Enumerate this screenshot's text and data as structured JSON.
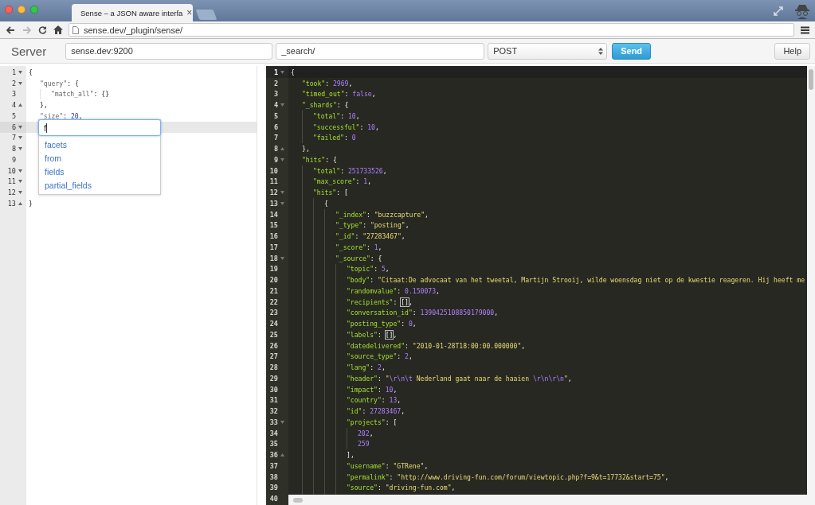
{
  "browser": {
    "tab_title": "Sense – a JSON aware interfa",
    "tab_close": "×",
    "url": "sense.dev/_plugin/sense/",
    "forward_disabled": true
  },
  "toolbar": {
    "title": "Server",
    "server": "sense.dev:9200",
    "path": "_search/",
    "method": "POST",
    "send": "Send",
    "help": "Help"
  },
  "request_editor": {
    "lines": [
      {
        "number": "1",
        "fold": true,
        "active": false,
        "tokens": [
          {
            "kind": "open",
            "text": "{"
          }
        ]
      },
      {
        "number": "2",
        "fold": true,
        "active": false,
        "tokens": [
          {
            "kind": "key",
            "text": "\"query\""
          },
          {
            "kind": "punct",
            "text": ": "
          },
          {
            "kind": "open",
            "text": "{"
          }
        ]
      },
      {
        "number": "3",
        "active": false,
        "tokens": [
          {
            "kind": "key",
            "text": "\"match_all\""
          },
          {
            "kind": "punct",
            "text": ": {}"
          }
        ]
      },
      {
        "number": "4",
        "fold": true,
        "active": false,
        "tokens": [
          {
            "kind": "close",
            "text": "}"
          },
          {
            "kind": "punct",
            "text": ","
          }
        ]
      },
      {
        "number": "5",
        "active": false,
        "tokens": [
          {
            "kind": "key",
            "text": "\"size\""
          },
          {
            "kind": "punct",
            "text": ": "
          },
          {
            "kind": "num",
            "text": "20"
          },
          {
            "kind": "punct",
            "text": ","
          }
        ]
      },
      {
        "number": "6",
        "fold": true,
        "active": true
      },
      {
        "number": "7",
        "fold": true,
        "active": false
      },
      {
        "number": "8",
        "fold": true,
        "active": false
      },
      {
        "number": "9",
        "active": false
      },
      {
        "number": "10",
        "fold": true,
        "active": false
      },
      {
        "number": "11",
        "fold": true,
        "active": false
      },
      {
        "number": "12",
        "fold": true,
        "active": false
      },
      {
        "number": "13",
        "fold": true,
        "active": false,
        "tokens": [
          {
            "kind": "close",
            "text": "}"
          }
        ]
      }
    ],
    "autocomplete": {
      "value": "f",
      "suggestions": [
        "facets",
        "from",
        "fields",
        "partial_fields"
      ]
    }
  },
  "response_editor": {
    "lines": [
      {
        "number": "1",
        "fold": true,
        "active": true,
        "tokens": [
          {
            "kind": "open",
            "text": "{"
          }
        ]
      },
      {
        "number": "2",
        "active": false,
        "tokens": [
          {
            "kind": "key",
            "text": "\"took\""
          },
          {
            "kind": "punct",
            "text": ": "
          },
          {
            "kind": "num",
            "text": "2969"
          },
          {
            "kind": "punct",
            "text": ","
          }
        ]
      },
      {
        "number": "3",
        "active": false,
        "tokens": [
          {
            "kind": "key",
            "text": "\"timed_out\""
          },
          {
            "kind": "punct",
            "text": ": "
          },
          {
            "kind": "num",
            "text": "false"
          },
          {
            "kind": "punct",
            "text": ","
          }
        ]
      },
      {
        "number": "4",
        "fold": true,
        "active": false,
        "tokens": [
          {
            "kind": "key",
            "text": "\"_shards\""
          },
          {
            "kind": "punct",
            "text": ": "
          },
          {
            "kind": "open",
            "text": "{"
          }
        ]
      },
      {
        "number": "5",
        "active": false,
        "tokens": [
          {
            "kind": "key",
            "text": "\"total\""
          },
          {
            "kind": "punct",
            "text": ": "
          },
          {
            "kind": "num",
            "text": "10"
          },
          {
            "kind": "punct",
            "text": ","
          }
        ]
      },
      {
        "number": "6",
        "active": false,
        "tokens": [
          {
            "kind": "key",
            "text": "\"successful\""
          },
          {
            "kind": "punct",
            "text": ": "
          },
          {
            "kind": "num",
            "text": "10"
          },
          {
            "kind": "punct",
            "text": ","
          }
        ]
      },
      {
        "number": "7",
        "active": false,
        "tokens": [
          {
            "kind": "key",
            "text": "\"failed\""
          },
          {
            "kind": "punct",
            "text": ": "
          },
          {
            "kind": "num",
            "text": "0"
          }
        ]
      },
      {
        "number": "8",
        "fold": true,
        "active": false,
        "tokens": [
          {
            "kind": "close",
            "text": "}"
          },
          {
            "kind": "punct",
            "text": ","
          }
        ]
      },
      {
        "number": "9",
        "fold": true,
        "active": false,
        "tokens": [
          {
            "kind": "key",
            "text": "\"hits\""
          },
          {
            "kind": "punct",
            "text": ": "
          },
          {
            "kind": "open",
            "text": "{"
          }
        ]
      },
      {
        "number": "10",
        "active": false,
        "tokens": [
          {
            "kind": "key",
            "text": "\"total\""
          },
          {
            "kind": "punct",
            "text": ": "
          },
          {
            "kind": "num",
            "text": "251733526"
          },
          {
            "kind": "punct",
            "text": ","
          }
        ]
      },
      {
        "number": "11",
        "active": false,
        "tokens": [
          {
            "kind": "key",
            "text": "\"max_score\""
          },
          {
            "kind": "punct",
            "text": ": "
          },
          {
            "kind": "num",
            "text": "1"
          },
          {
            "kind": "punct",
            "text": ","
          }
        ]
      },
      {
        "number": "12",
        "fold": true,
        "active": false,
        "tokens": [
          {
            "kind": "key",
            "text": "\"hits\""
          },
          {
            "kind": "punct",
            "text": ": "
          },
          {
            "kind": "open",
            "text": "["
          }
        ]
      },
      {
        "number": "13",
        "fold": true,
        "active": false,
        "tokens": [
          {
            "kind": "open",
            "text": "{"
          }
        ]
      },
      {
        "number": "14",
        "active": false,
        "tokens": [
          {
            "kind": "key",
            "text": "\"_index\""
          },
          {
            "kind": "punct",
            "text": ": "
          },
          {
            "kind": "str",
            "text": "\"buzzcapture\""
          },
          {
            "kind": "punct",
            "text": ","
          }
        ]
      },
      {
        "number": "15",
        "active": false,
        "tokens": [
          {
            "kind": "key",
            "text": "\"_type\""
          },
          {
            "kind": "punct",
            "text": ": "
          },
          {
            "kind": "str",
            "text": "\"posting\""
          },
          {
            "kind": "punct",
            "text": ","
          }
        ]
      },
      {
        "number": "16",
        "active": false,
        "tokens": [
          {
            "kind": "key",
            "text": "\"_id\""
          },
          {
            "kind": "punct",
            "text": ": "
          },
          {
            "kind": "str",
            "text": "\"27283467\""
          },
          {
            "kind": "punct",
            "text": ","
          }
        ]
      },
      {
        "number": "17",
        "active": false,
        "tokens": [
          {
            "kind": "key",
            "text": "\"_score\""
          },
          {
            "kind": "punct",
            "text": ": "
          },
          {
            "kind": "num",
            "text": "1"
          },
          {
            "kind": "punct",
            "text": ","
          }
        ]
      },
      {
        "number": "18",
        "fold": true,
        "active": false,
        "tokens": [
          {
            "kind": "key",
            "text": "\"_source\""
          },
          {
            "kind": "punct",
            "text": ": "
          },
          {
            "kind": "open",
            "text": "{"
          }
        ]
      },
      {
        "number": "19",
        "active": false,
        "tokens": [
          {
            "kind": "key",
            "text": "\"topic\""
          },
          {
            "kind": "punct",
            "text": ": "
          },
          {
            "kind": "num",
            "text": "5"
          },
          {
            "kind": "punct",
            "text": ","
          }
        ]
      },
      {
        "number": "20",
        "active": false,
        "tokens": [
          {
            "kind": "key",
            "text": "\"body\""
          },
          {
            "kind": "punct",
            "text": ": "
          },
          {
            "kind": "str",
            "text": "\"Citaat:De advocaat van het tweetal, Martijn Strooij, wilde woensdag niet op de kwestie reageren. Hij heeft me"
          }
        ]
      },
      {
        "number": "21",
        "active": false,
        "tokens": [
          {
            "kind": "key",
            "text": "\"randomvalue\""
          },
          {
            "kind": "punct",
            "text": ": "
          },
          {
            "kind": "num",
            "text": "0.150073"
          },
          {
            "kind": "punct",
            "text": ","
          }
        ]
      },
      {
        "number": "22",
        "active": false,
        "tokens": [
          {
            "kind": "key",
            "text": "\"recipients\""
          },
          {
            "kind": "punct",
            "text": ": "
          },
          {
            "kind": "empty",
            "text": "[]"
          },
          {
            "kind": "punct",
            "text": ","
          }
        ]
      },
      {
        "number": "23",
        "active": false,
        "tokens": [
          {
            "kind": "key",
            "text": "\"conversation_id\""
          },
          {
            "kind": "punct",
            "text": ": "
          },
          {
            "kind": "num",
            "text": "1390425108850179000"
          },
          {
            "kind": "punct",
            "text": ","
          }
        ]
      },
      {
        "number": "24",
        "active": false,
        "tokens": [
          {
            "kind": "key",
            "text": "\"posting_type\""
          },
          {
            "kind": "punct",
            "text": ": "
          },
          {
            "kind": "num",
            "text": "0"
          },
          {
            "kind": "punct",
            "text": ","
          }
        ]
      },
      {
        "number": "25",
        "active": false,
        "tokens": [
          {
            "kind": "key",
            "text": "\"labels\""
          },
          {
            "kind": "punct",
            "text": ": "
          },
          {
            "kind": "empty",
            "text": "[]"
          },
          {
            "kind": "punct",
            "text": ","
          }
        ]
      },
      {
        "number": "26",
        "active": false,
        "tokens": [
          {
            "kind": "key",
            "text": "\"datedelivered\""
          },
          {
            "kind": "punct",
            "text": ": "
          },
          {
            "kind": "str",
            "text": "\"2010-01-28T18:00:00.000000\""
          },
          {
            "kind": "punct",
            "text": ","
          }
        ]
      },
      {
        "number": "27",
        "active": false,
        "tokens": [
          {
            "kind": "key",
            "text": "\"source_type\""
          },
          {
            "kind": "punct",
            "text": ": "
          },
          {
            "kind": "num",
            "text": "2"
          },
          {
            "kind": "punct",
            "text": ","
          }
        ]
      },
      {
        "number": "28",
        "active": false,
        "tokens": [
          {
            "kind": "key",
            "text": "\"lang\""
          },
          {
            "kind": "punct",
            "text": ": "
          },
          {
            "kind": "num",
            "text": "2"
          },
          {
            "kind": "punct",
            "text": ","
          }
        ]
      },
      {
        "number": "29",
        "active": false,
        "tokens": [
          {
            "kind": "key",
            "text": "\"header\""
          },
          {
            "kind": "punct",
            "text": ": "
          },
          {
            "kind": "str",
            "text": "\""
          },
          {
            "kind": "esc",
            "text": "\\r\\n\\t"
          },
          {
            "kind": "str",
            "text": " Nederland gaat naar de haaien "
          },
          {
            "kind": "esc",
            "text": "\\r\\n\\r\\n"
          },
          {
            "kind": "str",
            "text": "\""
          },
          {
            "kind": "punct",
            "text": ","
          }
        ]
      },
      {
        "number": "30",
        "active": false,
        "tokens": [
          {
            "kind": "key",
            "text": "\"impact\""
          },
          {
            "kind": "punct",
            "text": ": "
          },
          {
            "kind": "num",
            "text": "10"
          },
          {
            "kind": "punct",
            "text": ","
          }
        ]
      },
      {
        "number": "31",
        "active": false,
        "tokens": [
          {
            "kind": "key",
            "text": "\"country\""
          },
          {
            "kind": "punct",
            "text": ": "
          },
          {
            "kind": "num",
            "text": "13"
          },
          {
            "kind": "punct",
            "text": ","
          }
        ]
      },
      {
        "number": "32",
        "active": false,
        "tokens": [
          {
            "kind": "key",
            "text": "\"id\""
          },
          {
            "kind": "punct",
            "text": ": "
          },
          {
            "kind": "num",
            "text": "27283467"
          },
          {
            "kind": "punct",
            "text": ","
          }
        ]
      },
      {
        "number": "33",
        "fold": true,
        "active": false,
        "tokens": [
          {
            "kind": "key",
            "text": "\"projects\""
          },
          {
            "kind": "punct",
            "text": ": "
          },
          {
            "kind": "open",
            "text": "["
          }
        ]
      },
      {
        "number": "34",
        "active": false,
        "tokens": [
          {
            "kind": "num",
            "text": "202"
          },
          {
            "kind": "punct",
            "text": ","
          }
        ]
      },
      {
        "number": "35",
        "active": false,
        "tokens": [
          {
            "kind": "num",
            "text": "259"
          }
        ]
      },
      {
        "number": "36",
        "fold": true,
        "active": false,
        "tokens": [
          {
            "kind": "close",
            "text": "]"
          },
          {
            "kind": "punct",
            "text": ","
          }
        ]
      },
      {
        "number": "37",
        "active": false,
        "tokens": [
          {
            "kind": "key",
            "text": "\"username\""
          },
          {
            "kind": "punct",
            "text": ": "
          },
          {
            "kind": "str",
            "text": "\"GTRene\""
          },
          {
            "kind": "punct",
            "text": ","
          }
        ]
      },
      {
        "number": "38",
        "active": false,
        "tokens": [
          {
            "kind": "key",
            "text": "\"permalink\""
          },
          {
            "kind": "punct",
            "text": ": "
          },
          {
            "kind": "str",
            "text": "\"http://www.driving-fun.com/forum/viewtopic.php?f=9&t=17732&start=75\""
          },
          {
            "kind": "punct",
            "text": ","
          }
        ]
      },
      {
        "number": "39",
        "active": false,
        "tokens": [
          {
            "kind": "key",
            "text": "\"source\""
          },
          {
            "kind": "punct",
            "text": ": "
          },
          {
            "kind": "str",
            "text": "\"driving-fun.com\""
          },
          {
            "kind": "punct",
            "text": ","
          }
        ]
      },
      {
        "number": "40",
        "active": false
      }
    ]
  }
}
